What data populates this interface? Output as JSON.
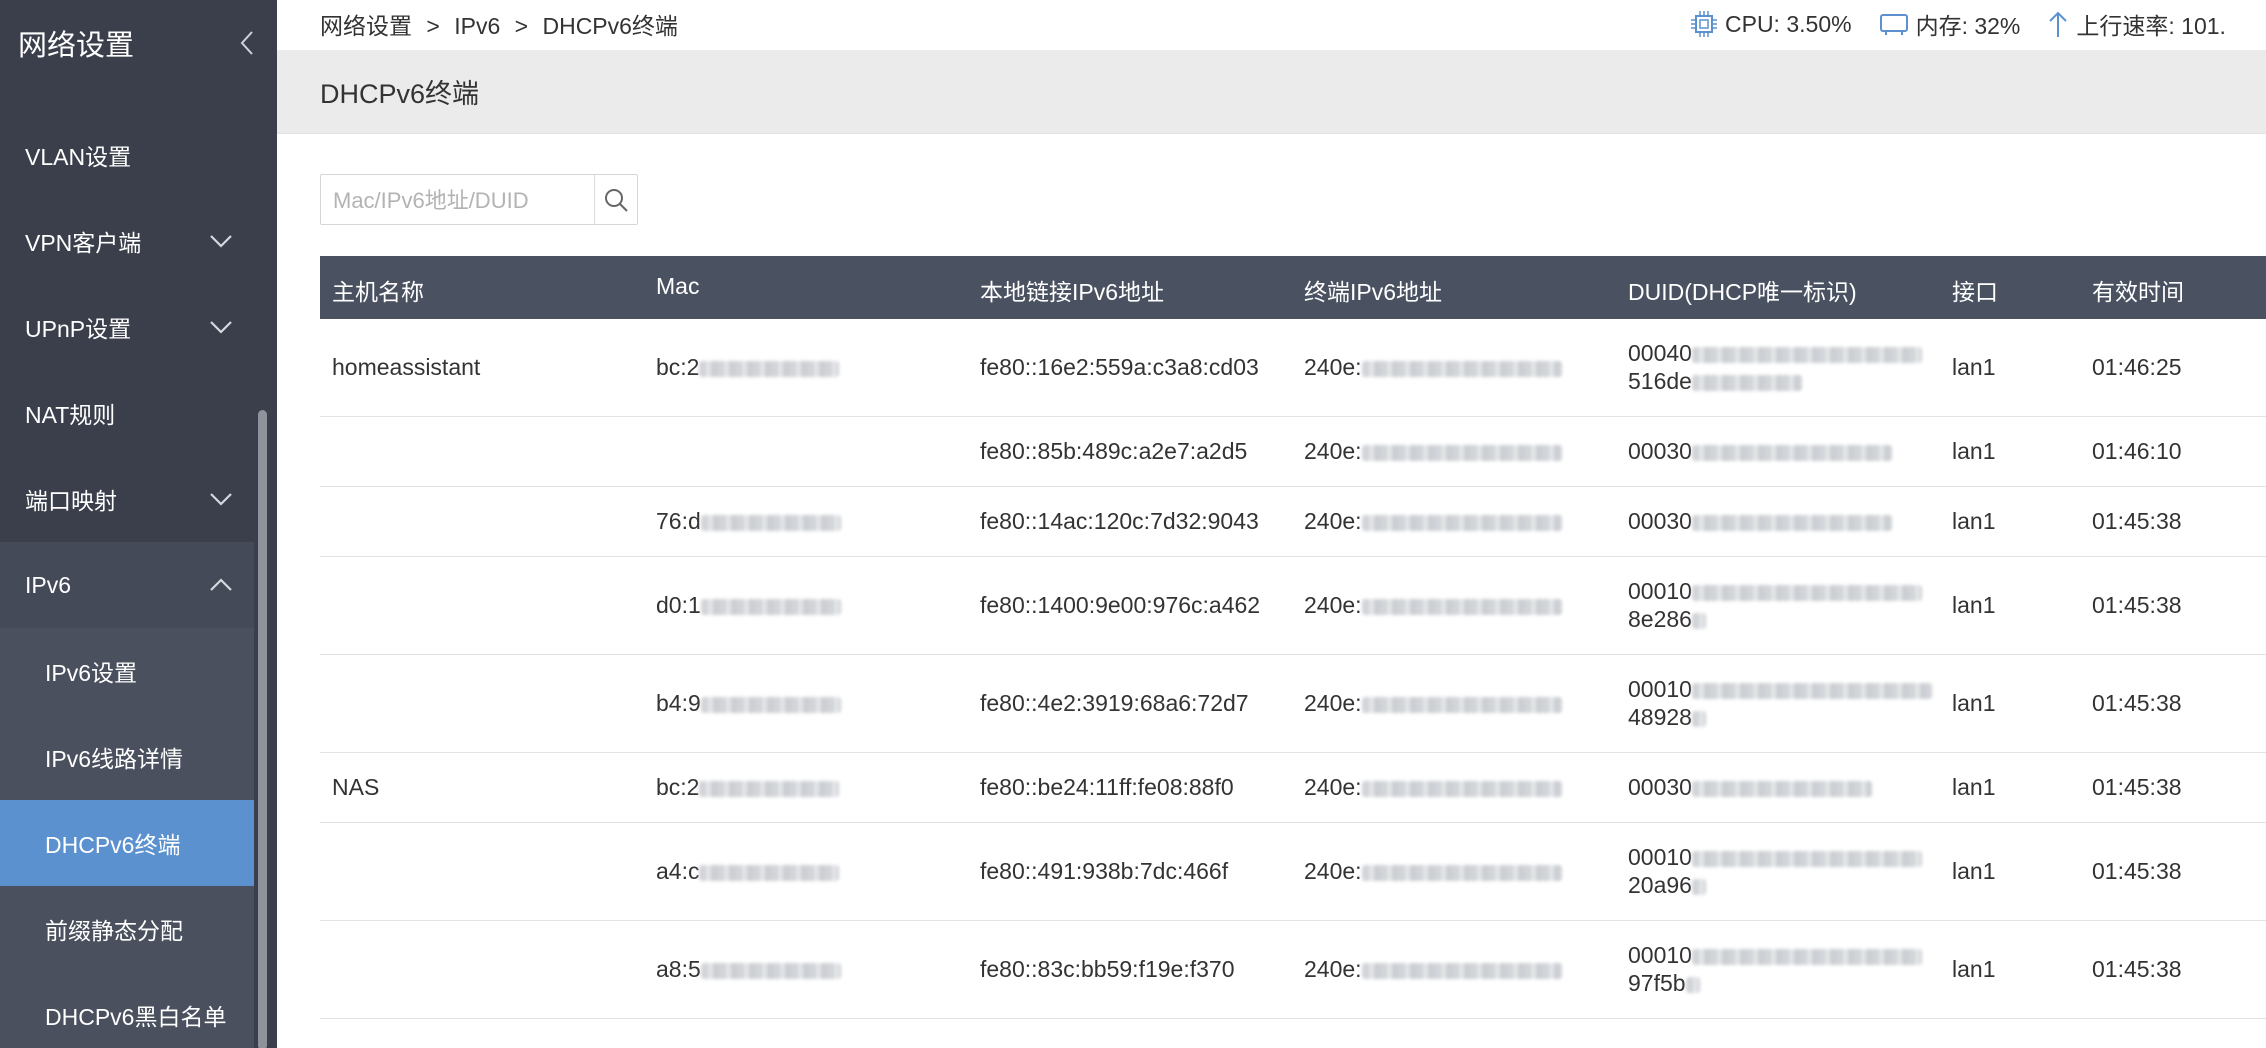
{
  "sidebar": {
    "title": "网络设置",
    "items": [
      {
        "label": "VLAN设置",
        "has_children": false
      },
      {
        "label": "VPN客户端",
        "has_children": true
      },
      {
        "label": "UPnP设置",
        "has_children": true
      },
      {
        "label": "NAT规则",
        "has_children": false
      },
      {
        "label": "端口映射",
        "has_children": true
      },
      {
        "label": "IPv6",
        "has_children": true,
        "expanded": true
      }
    ],
    "subitems": [
      {
        "label": "IPv6设置"
      },
      {
        "label": "IPv6线路详情"
      },
      {
        "label": "DHCPv6终端",
        "active": true
      },
      {
        "label": "前缀静态分配"
      },
      {
        "label": "DHCPv6黑白名单"
      }
    ]
  },
  "breadcrumb": {
    "items": [
      "网络设置",
      ">",
      "IPv6",
      ">",
      "DHCPv6终端"
    ]
  },
  "stats": {
    "cpu": "CPU: 3.50%",
    "memory": "内存: 32%",
    "upload": "上行速率: 101."
  },
  "page": {
    "title": "DHCPv6终端"
  },
  "search": {
    "placeholder": "Mac/IPv6地址/DUID",
    "value": ""
  },
  "table": {
    "headers": [
      "主机名称",
      "Mac",
      "本地链接IPv6地址",
      "终端IPv6地址",
      "DUID(DHCP唯一标识)",
      "接口",
      "有效时间"
    ],
    "rows": [
      {
        "host": "homeassistant",
        "mac": "bc:2",
        "link_local": "fe80::16e2:559a:c3a8:cd03",
        "ipv6": "240e:",
        "duid1": "00040",
        "duid2": "516de",
        "iface": "lan1",
        "time": "01:46:25"
      },
      {
        "host": "",
        "mac": "",
        "link_local": "fe80::85b:489c:a2e7:a2d5",
        "ipv6": "240e:",
        "duid1": "00030",
        "duid2": "",
        "iface": "lan1",
        "time": "01:46:10"
      },
      {
        "host": "",
        "mac": "76:d",
        "link_local": "fe80::14ac:120c:7d32:9043",
        "ipv6": "240e:",
        "duid1": "00030",
        "duid2": "",
        "iface": "lan1",
        "time": "01:45:38"
      },
      {
        "host": "",
        "mac": "d0:1",
        "link_local": "fe80::1400:9e00:976c:a462",
        "ipv6": "240e:",
        "duid1": "00010",
        "duid2": "8e286",
        "iface": "lan1",
        "time": "01:45:38"
      },
      {
        "host": "",
        "mac": "b4:9",
        "link_local": "fe80::4e2:3919:68a6:72d7",
        "ipv6": "240e:",
        "duid1": "00010",
        "duid2": "48928",
        "iface": "lan1",
        "time": "01:45:38"
      },
      {
        "host": "NAS",
        "mac": "bc:2",
        "link_local": "fe80::be24:11ff:fe08:88f0",
        "ipv6": "240e:",
        "duid1": "00030",
        "duid2": "",
        "iface": "lan1",
        "time": "01:45:38"
      },
      {
        "host": "",
        "mac": "a4:c",
        "link_local": "fe80::491:938b:7dc:466f",
        "ipv6": "240e:",
        "duid1": "00010",
        "duid2": "20a96",
        "iface": "lan1",
        "time": "01:45:38"
      },
      {
        "host": "",
        "mac": "a8:5",
        "link_local": "fe80::83c:bb59:f19e:f370",
        "ipv6": "240e:",
        "duid1": "00010",
        "duid2": "97f5b",
        "iface": "lan1",
        "time": "01:45:38"
      }
    ]
  }
}
